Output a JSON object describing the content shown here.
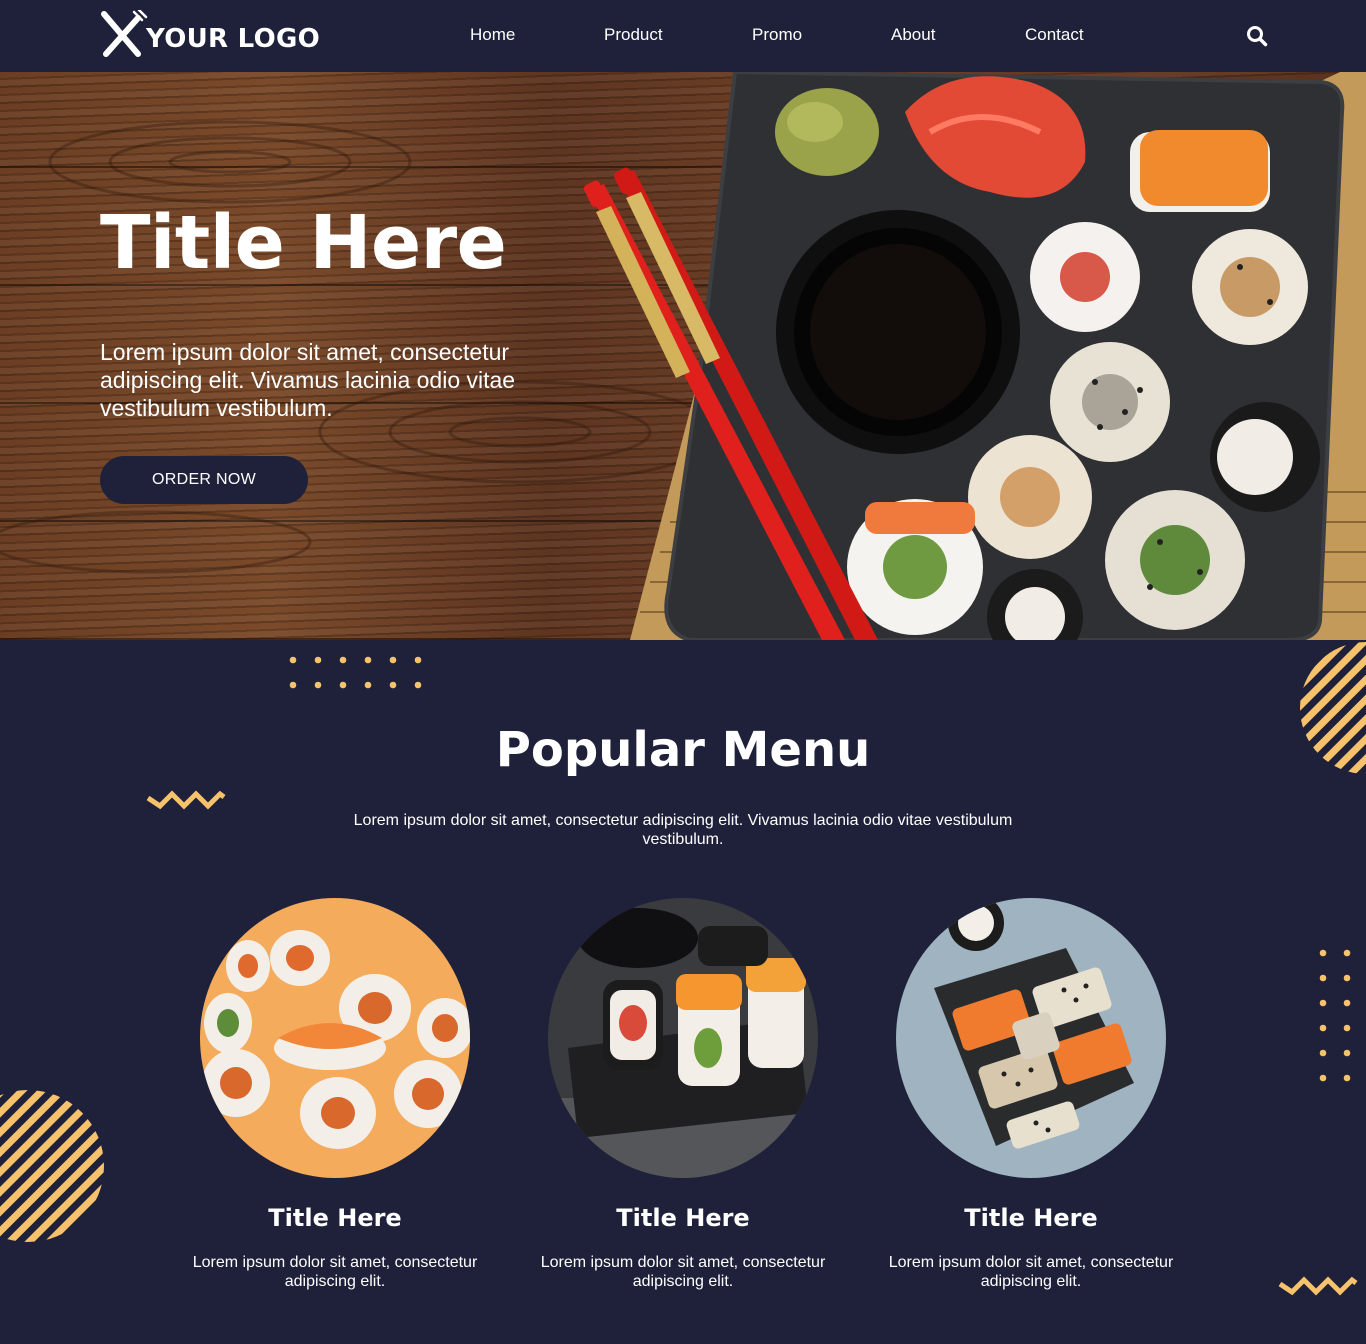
{
  "header": {
    "logo_text": "YOUR LOGO",
    "nav": [
      "Home",
      "Product",
      "Promo",
      "About",
      "Contact"
    ]
  },
  "hero": {
    "title": "Title Here",
    "text": "Lorem ipsum dolor sit amet, consectetur adipiscing elit. Vivamus lacinia odio vitae vestibulum vestibulum.",
    "button_label": "ORDER NOW"
  },
  "menu": {
    "title": "Popular Menu",
    "text": "Lorem ipsum dolor sit amet, consectetur adipiscing elit. Vivamus lacinia odio vitae vestibulum vestibulum.",
    "cards": [
      {
        "title": "Title Here",
        "text": "Lorem ipsum dolor sit amet, consectetur adipiscing elit."
      },
      {
        "title": "Title Here",
        "text": "Lorem ipsum dolor sit amet, consectetur adipiscing elit."
      },
      {
        "title": "Title Here",
        "text": "Lorem ipsum dolor sit amet, consectetur adipiscing elit."
      }
    ]
  },
  "colors": {
    "navy": "#1e2139",
    "accent_yellow": "#f6c26b",
    "wood": "#6b3e23"
  },
  "icons": {
    "logo": "fork-knife-icon",
    "search": "search-icon"
  }
}
